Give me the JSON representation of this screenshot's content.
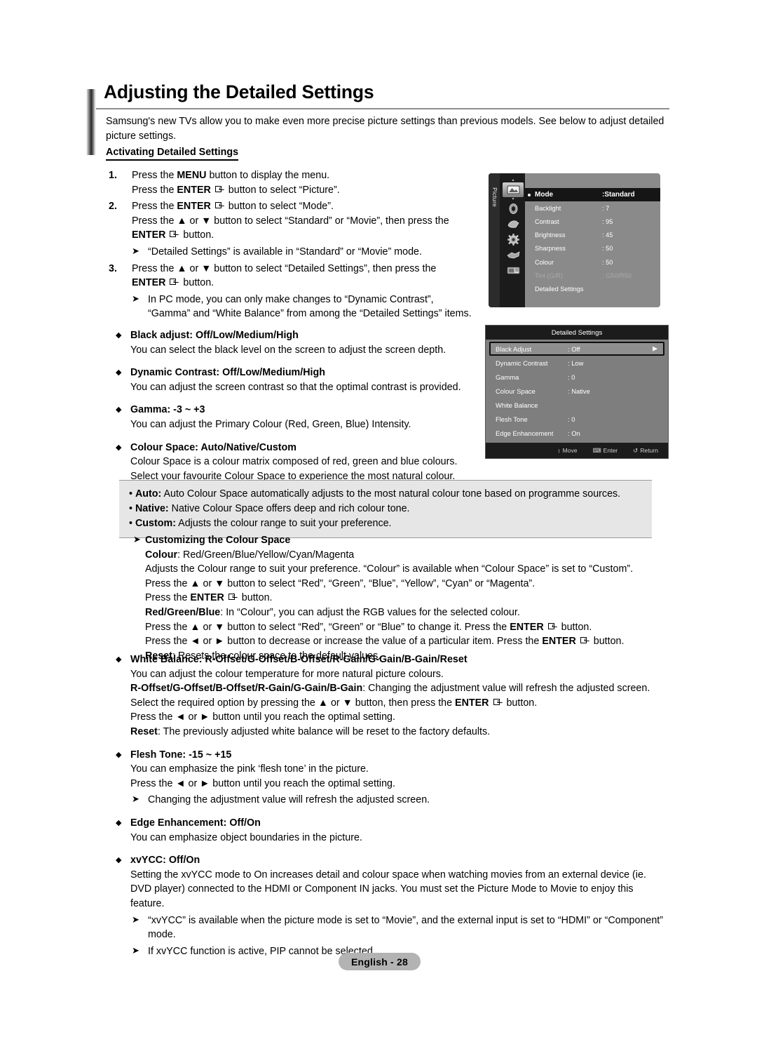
{
  "header": {
    "title": "Adjusting the Detailed Settings",
    "intro": "Samsung's new TVs allow you to make even more precise picture settings than previous models. See below to adjust detailed picture settings.",
    "subhead": "Activating Detailed Settings"
  },
  "steps": [
    {
      "num": "1.",
      "lines": [
        "Press the MENU button to display the menu.",
        "Press the ENTER ⌨ button to select “Picture”."
      ]
    },
    {
      "num": "2.",
      "lines": [
        "Press the ENTER ⌨ button to select “Mode”.",
        "Press the ▲ or ▼ button to select “Standard” or “Movie”, then press the",
        "ENTER ⌨ button."
      ],
      "note": "“Detailed Settings” is available in “Standard” or “Movie” mode."
    },
    {
      "num": "3.",
      "lines": [
        "Press the ▲ or ▼ button to select “Detailed Settings”, then press the",
        "ENTER ⌨ button."
      ],
      "note": "In PC mode, you can only make changes to “Dynamic Contrast”,",
      "note2": "“Gamma” and “White Balance” from among the “Detailed Settings” items."
    }
  ],
  "bullets_top": [
    {
      "head": "Black adjust: Off/Low/Medium/High",
      "body": [
        "You can select the black level on the screen to adjust the screen depth."
      ]
    },
    {
      "head": "Dynamic Contrast: Off/Low/Medium/High",
      "body": [
        "You can adjust the screen contrast so that the optimal contrast is provided."
      ]
    },
    {
      "head": "Gamma: -3 ~ +3",
      "body": [
        "You can adjust the Primary Colour (Red, Green, Blue) Intensity."
      ]
    },
    {
      "head": "Colour Space: Auto/Native/Custom",
      "body": [
        "Colour Space is a colour matrix composed of red, green and blue colours.",
        "Select your favourite Colour Space to experience the most natural colour."
      ]
    }
  ],
  "greybox": [
    {
      "term": "Auto:",
      "text": " Auto Colour Space automatically adjusts to the most natural colour tone based on programme sources."
    },
    {
      "term": "Native:",
      "text": " Native Colour Space offers deep and rich colour tone."
    },
    {
      "term": "Custom:",
      "text": " Adjusts the colour range to suit your preference."
    }
  ],
  "custom_block": {
    "heading": "Customizing the Colour Space",
    "lines": [
      {
        "term": "Colour",
        "text": ": Red/Green/Blue/Yellow/Cyan/Magenta"
      },
      {
        "term": "",
        "text": "Adjusts the Colour range to suit your preference. “Colour” is available when “Colour Space” is set to “Custom”."
      },
      {
        "term": "",
        "text": "Press the ▲ or ▼ button to select “Red”, “Green”, “Blue”, “Yellow”, “Cyan” or “Magenta”."
      },
      {
        "term": "",
        "text": "Press the ENTER ⌨ button."
      },
      {
        "term": "Red/Green/Blue",
        "text": ": In “Colour”, you can adjust the RGB values for the selected colour."
      },
      {
        "term": "",
        "text": "Press the ▲ or ▼ button to select “Red”, “Green” or “Blue” to change it. Press the ENTER ⌨ button."
      },
      {
        "term": "",
        "text": "Press the ◄ or ► button to decrease or increase the value of a particular item. Press the ENTER ⌨ button."
      },
      {
        "term": "Reset",
        "text": ": Resets the colour space to the default values."
      }
    ]
  },
  "bullets_bottom": [
    {
      "head": "White Balance: R-Offset/G-Offset/B-Offset/R-Gain/G-Gain/B-Gain/Reset",
      "body": [
        "You can adjust the colour temperature for more natural picture colours.",
        "R-Offset/G-Offset/B-Offset/R-Gain/G-Gain/B-Gain: Changing the adjustment value will refresh the adjusted screen.",
        "Select the required option by pressing the ▲ or ▼ button, then press the ENTER ⌨ button.",
        "Press the ◄ or ► button until you reach the optimal setting.",
        "Reset: The previously adjusted white balance will be reset to the factory defaults."
      ]
    },
    {
      "head": "Flesh Tone: -15 ~ +15",
      "body": [
        "You can emphasize the pink ‘flesh tone’ in the picture.",
        "Press the ◄ or ► button until you reach the optimal setting."
      ],
      "notes": [
        "Changing the adjustment value will refresh the adjusted screen."
      ]
    },
    {
      "head": "Edge Enhancement: Off/On",
      "body": [
        "You can emphasize object boundaries in the picture."
      ]
    },
    {
      "head": "xvYCC: Off/On",
      "body": [
        "Setting the xvYCC mode to On increases detail and colour space when watching movies from an external device (ie.",
        "DVD player) connected to the HDMI or Component IN jacks. You must set the Picture Mode to Movie to enjoy this",
        "feature."
      ],
      "notes": [
        "“xvYCC” is available when the picture mode is set to “Movie”, and the external input is set to “HDMI” or “Component” mode.",
        "If xvYCC function is active, PIP cannot be selected."
      ]
    }
  ],
  "footer": {
    "page_label": "English - 28"
  },
  "osd_picture": {
    "rail_label": "Picture",
    "icons": [
      "picture-icon",
      "sound-icon",
      "channel-icon",
      "setup-icon",
      "input-icon",
      "media-icon"
    ],
    "rows": [
      {
        "label": "Mode",
        "value": ":Standard",
        "state": "highlighted"
      },
      {
        "label": "Backlight",
        "value": ": 7",
        "state": "normal"
      },
      {
        "label": "Contrast",
        "value": ": 95",
        "state": "normal"
      },
      {
        "label": "Brightness",
        "value": ": 45",
        "state": "normal"
      },
      {
        "label": "Sharpness",
        "value": ": 50",
        "state": "normal"
      },
      {
        "label": "Colour",
        "value": ": 50",
        "state": "normal"
      },
      {
        "label": "Tint (G/R)",
        "value": ": G50/R50",
        "state": "dimmed"
      },
      {
        "label": "Detailed Settings",
        "value": "",
        "state": "normal"
      }
    ]
  },
  "osd_detailed": {
    "title": "Detailed Settings",
    "rows": [
      {
        "label": "Black Adjust",
        "value": ": Off",
        "state": "highlighted",
        "arrow": "▶"
      },
      {
        "label": "Dynamic Contrast",
        "value": ": Low",
        "state": "normal",
        "arrow": ""
      },
      {
        "label": "Gamma",
        "value": ": 0",
        "state": "normal",
        "arrow": ""
      },
      {
        "label": "Colour Space",
        "value": ": Native",
        "state": "normal",
        "arrow": ""
      },
      {
        "label": "White Balance",
        "value": "",
        "state": "normal",
        "arrow": ""
      },
      {
        "label": "Flesh Tone",
        "value": ": 0",
        "state": "normal",
        "arrow": ""
      },
      {
        "label": "Edge Enhancement",
        "value": ": On",
        "state": "normal",
        "arrow": ""
      }
    ],
    "bottom_bar": [
      {
        "icon": "↕",
        "label": "Move"
      },
      {
        "icon": "⌨",
        "label": "Enter"
      },
      {
        "icon": "↺",
        "label": "Return"
      }
    ]
  }
}
